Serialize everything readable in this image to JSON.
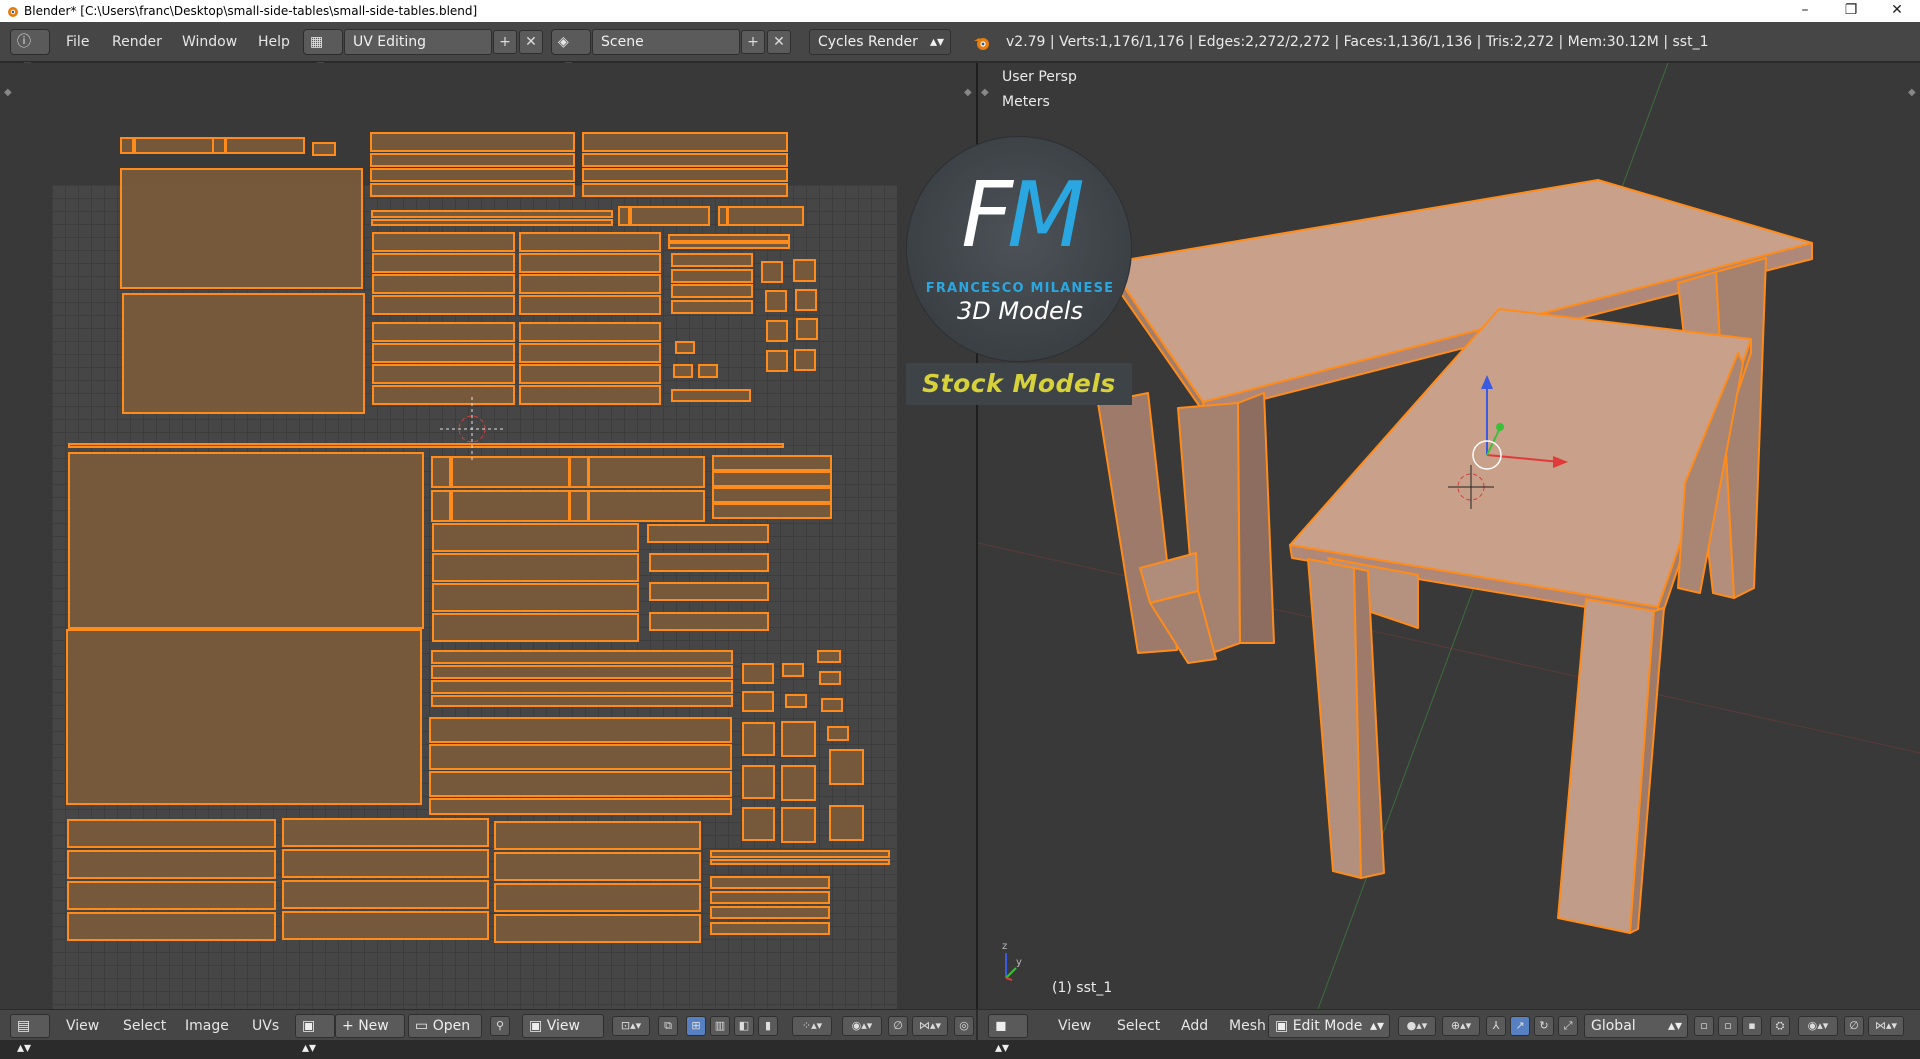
{
  "window": {
    "title": "Blender* [C:\\Users\\franc\\Desktop\\small-side-tables\\small-side-tables.blend]",
    "controls": [
      "–",
      "❐",
      "✕"
    ]
  },
  "info_header": {
    "menus": [
      "File",
      "Render",
      "Window",
      "Help"
    ],
    "layout": "UV Editing",
    "scene": "Scene",
    "engine": "Cycles Render",
    "stats": "v2.79 | Verts:1,176/1,176 | Edges:2,272/2,272 | Faces:1,136/1,136 | Tris:2,272 | Mem:30.12M | sst_1"
  },
  "viewport": {
    "view_name": "User Persp",
    "units": "Meters",
    "object_label": "(1) sst_1"
  },
  "logo": {
    "letter_f": "F",
    "letter_m": "M",
    "brand": "FRANCESCO MILANESE",
    "subtitle": "3D Models",
    "banner": "Stock Models"
  },
  "uv_footer": {
    "menus": [
      "View",
      "Select",
      "Image",
      "UVs"
    ],
    "new_label": "New",
    "open_label": "Open",
    "view_label": "View"
  },
  "view3d_footer": {
    "menus": [
      "View",
      "Select",
      "Add",
      "Mesh"
    ],
    "mode": "Edit Mode",
    "orientation": "Global"
  },
  "colors": {
    "accent_orange": "#ff8c1a",
    "uv_fill": "#7a5a3a",
    "table_top": "#c9a089",
    "table_side": "#a7826c"
  }
}
